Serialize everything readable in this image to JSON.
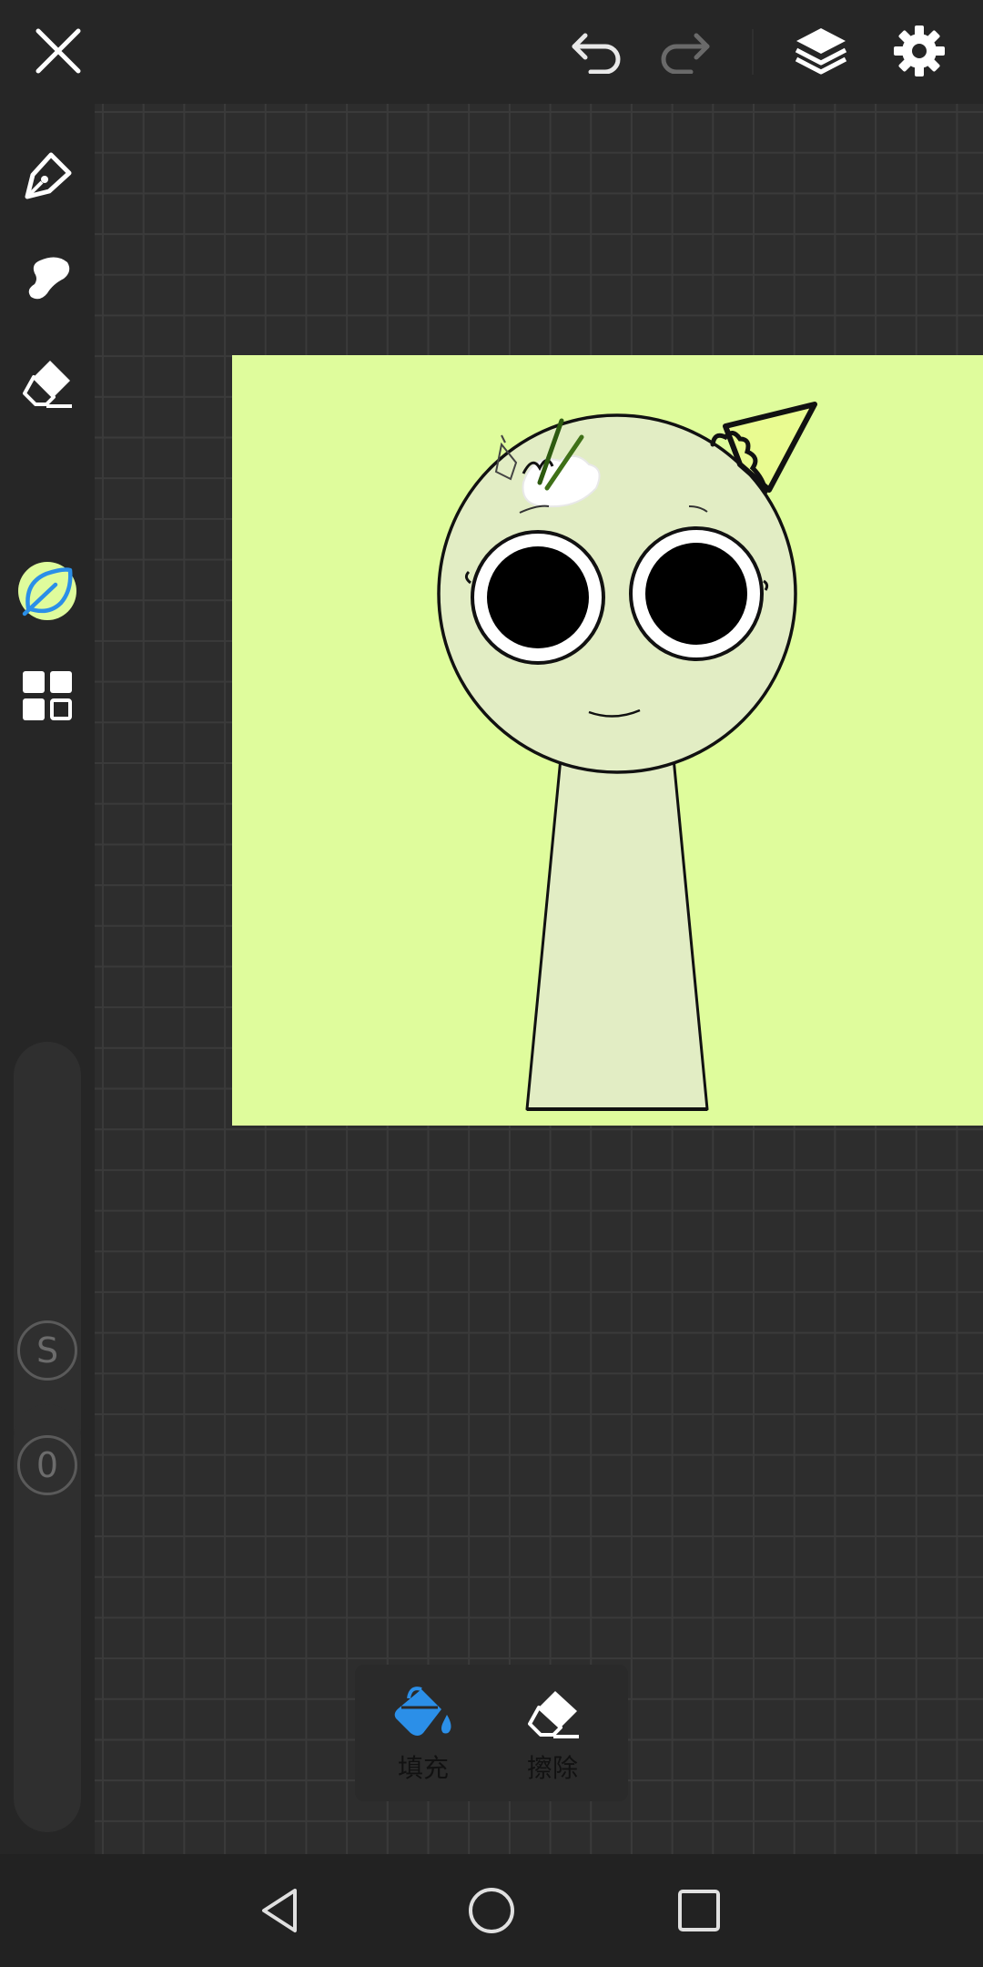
{
  "colors": {
    "canvas_bg": "#dffc9c",
    "brush_color": "#dffc9c",
    "accent_blue": "#2b8fe8",
    "character_fill": "#e2edc4",
    "hat_fill": "#e9fb91"
  },
  "toolbar": {
    "icons": [
      "close-icon",
      "undo-icon",
      "redo-icon",
      "layers-icon",
      "settings-icon"
    ]
  },
  "sidebar": {
    "tools": [
      "pen-icon",
      "smudge-icon",
      "eraser-icon",
      "color-swatch",
      "leaf-brush-icon",
      "grid-icon"
    ],
    "active_tool": "leaf-brush-icon",
    "size_slider_label": "S",
    "opacity_slider_label": "0"
  },
  "popup": {
    "fill_label": "填充",
    "erase_label": "擦除"
  },
  "nav": {
    "icons": [
      "back-icon",
      "home-icon",
      "recents-icon"
    ]
  }
}
